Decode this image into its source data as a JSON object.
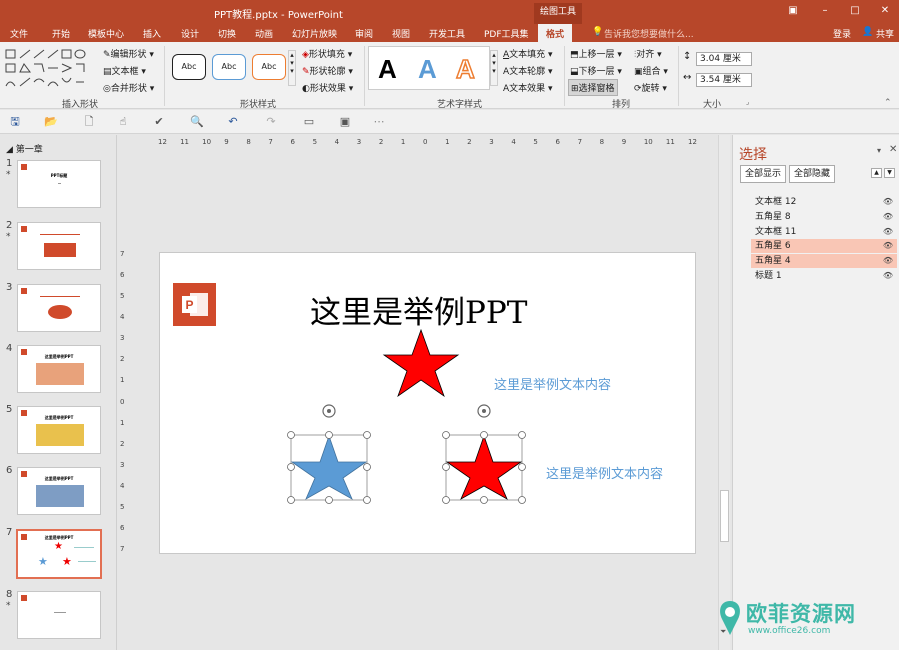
{
  "window": {
    "title": "PPT教程.pptx - PowerPoint",
    "context_tab": "绘图工具",
    "login": "登录",
    "share": "共享"
  },
  "tabs": [
    "文件",
    "开始",
    "模板中心",
    "插入",
    "设计",
    "切换",
    "动画",
    "幻灯片放映",
    "审阅",
    "视图",
    "开发工具",
    "PDF工具集",
    "格式"
  ],
  "tell_me": "告诉我您想要做什么...",
  "ribbon": {
    "insert_shapes": {
      "label": "插入形状",
      "edit_shape": "编辑形状",
      "text_box": "文本框",
      "merge_shapes": "合并形状"
    },
    "shape_styles": {
      "label": "形状样式",
      "samples": [
        "Abc",
        "Abc",
        "Abc"
      ],
      "fill": "形状填充",
      "outline": "形状轮廓",
      "effects": "形状效果"
    },
    "wordart": {
      "label": "艺术字样式",
      "text_fill": "文本填充",
      "text_outline": "文本轮廓",
      "text_effects": "文本效果"
    },
    "arrange": {
      "label": "排列",
      "bring_forward": "上移一层",
      "send_backward": "下移一层",
      "selection_pane": "选择窗格",
      "align": "对齐",
      "group": "组合",
      "rotate": "旋转"
    },
    "size": {
      "label": "大小",
      "height": "3.04 厘米",
      "width": "3.54 厘米"
    }
  },
  "sections": {
    "first": "第一章"
  },
  "thumbnails": [
    {
      "num": "1",
      "star": "*",
      "title": "PPT标题"
    },
    {
      "num": "2",
      "star": "*",
      "title": ""
    },
    {
      "num": "3",
      "star": "",
      "title": ""
    },
    {
      "num": "4",
      "star": "",
      "title": "这里是举例PPT"
    },
    {
      "num": "5",
      "star": "",
      "title": "这里是举例PPT"
    },
    {
      "num": "6",
      "star": "",
      "title": "这里是举例PPT"
    },
    {
      "num": "7",
      "star": "",
      "title": "这里是举例PPT"
    },
    {
      "num": "8",
      "star": "*",
      "title": ""
    }
  ],
  "slide": {
    "title": "这里是举例PPT",
    "text1": "这里是举例文本内容",
    "text2": "这里是举例文本内容",
    "colors": {
      "red": "#ff0000",
      "blue": "#5b9bd5",
      "logo": "#d04a2b"
    }
  },
  "ruler": {
    "h": [
      "12",
      "11",
      "10",
      "9",
      "8",
      "7",
      "6",
      "5",
      "4",
      "3",
      "2",
      "1",
      "0",
      "1",
      "2",
      "3",
      "4",
      "5",
      "6",
      "7",
      "8",
      "9",
      "10",
      "11",
      "12"
    ],
    "v": [
      "7",
      "6",
      "5",
      "4",
      "3",
      "2",
      "1",
      "0",
      "1",
      "2",
      "3",
      "4",
      "5",
      "6",
      "7"
    ]
  },
  "selection_pane": {
    "title": "选择",
    "show_all": "全部显示",
    "hide_all": "全部隐藏",
    "items": [
      {
        "name": "文本框 12",
        "highlight": false
      },
      {
        "name": "五角星 8",
        "highlight": false
      },
      {
        "name": "文本框 11",
        "highlight": false
      },
      {
        "name": "五角星 6",
        "highlight": true
      },
      {
        "name": "五角星 4",
        "highlight": true
      },
      {
        "name": "标题 1",
        "highlight": false
      }
    ]
  },
  "watermark": {
    "name": "欧菲资源网",
    "url": "www.office26.com"
  }
}
